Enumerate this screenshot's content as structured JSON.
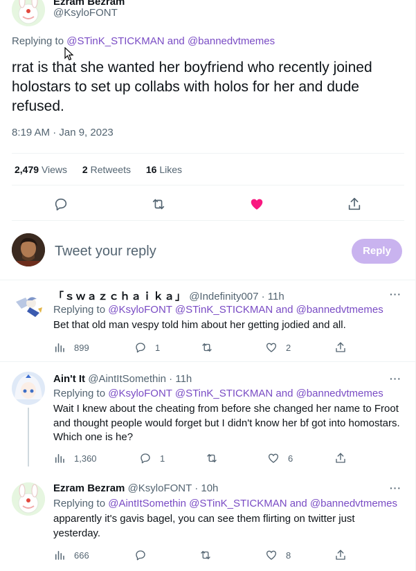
{
  "colors": {
    "link": "#794bc4",
    "like": "#f91880",
    "reply_btn": "#c9b3ef",
    "muted": "#536471"
  },
  "main_tweet": {
    "author_name": "Ezram Bezram",
    "handle": "@KsyloFONT",
    "replying_prefix": "Replying to ",
    "replying_to": "@STinK_STICKMAN and @bannedvtmemes",
    "text": "rrat is that she wanted her boyfriend who recently joined holostars to set up collabs with holos for her and dude refused.",
    "timestamp": "8:19 AM · Jan 9, 2023",
    "stats": [
      {
        "count": "2,479",
        "label": "Views"
      },
      {
        "count": "2",
        "label": "Retweets"
      },
      {
        "count": "16",
        "label": "Likes"
      }
    ],
    "actions": [
      "reply-icon",
      "retweet-icon",
      "like-icon-filled",
      "share-icon"
    ]
  },
  "compose": {
    "placeholder": "Tweet your reply",
    "button_label": "Reply"
  },
  "replies": [
    {
      "name": "「ｓｗａｚｃｈａｉｋａ」",
      "handle_time": "@Indefinity007 · 11h",
      "more": "···",
      "replying_prefix": "Replying to ",
      "replying_to": "@KsyloFONT @STinK_STICKMAN and @bannedvtmemes",
      "text": "Bet that old man vespy told him about her getting jodied and all.",
      "views": "899",
      "replies": "1",
      "retweets": "",
      "likes": "2"
    },
    {
      "name": "Ain't It",
      "handle_time": "@AintItSomethin · 11h",
      "more": "···",
      "replying_prefix": "Replying to ",
      "replying_to": "@KsyloFONT @STinK_STICKMAN and @bannedvtmemes",
      "text": "Wait I knew about the cheating from before she changed her name to Froot and thought people would forget but I didn't know her bf got into homostars. Which one is he?",
      "views": "1,360",
      "replies": "1",
      "retweets": "",
      "likes": "6"
    },
    {
      "name": "Ezram Bezram",
      "handle_time": "@KsyloFONT · 10h",
      "more": "···",
      "replying_prefix": "Replying to ",
      "replying_to": "@AintItSomethin @STinK_STICKMAN and @bannedvtmemes",
      "text": "apparently it's gavis bagel, you can see them flirting on twitter just yesterday.",
      "views": "666",
      "replies": "",
      "retweets": "",
      "likes": "8"
    }
  ]
}
